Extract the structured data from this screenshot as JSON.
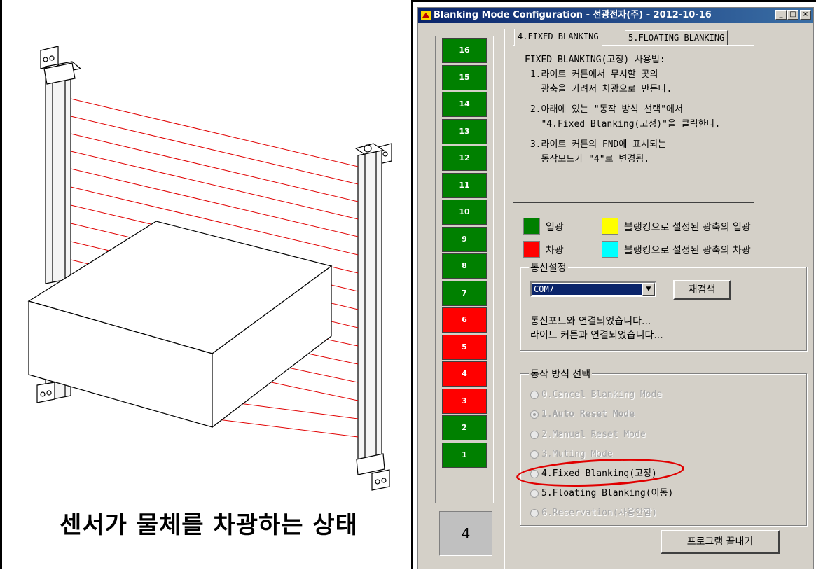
{
  "illustration": {
    "caption": "센서가 물체를 차광하는 상태"
  },
  "window": {
    "title": "Blanking Mode Configuration - 선광전자(주) - 2012-10-16",
    "controls": {
      "minimize": "_",
      "maximize": "□",
      "close": "×"
    }
  },
  "beams": [
    {
      "label": "16",
      "state": "on"
    },
    {
      "label": "15",
      "state": "on"
    },
    {
      "label": "14",
      "state": "on"
    },
    {
      "label": "13",
      "state": "on"
    },
    {
      "label": "12",
      "state": "on"
    },
    {
      "label": "11",
      "state": "on"
    },
    {
      "label": "10",
      "state": "on"
    },
    {
      "label": "9",
      "state": "on"
    },
    {
      "label": "8",
      "state": "on"
    },
    {
      "label": "7",
      "state": "on"
    },
    {
      "label": "6",
      "state": "off"
    },
    {
      "label": "5",
      "state": "off"
    },
    {
      "label": "4",
      "state": "off"
    },
    {
      "label": "3",
      "state": "off"
    },
    {
      "label": "2",
      "state": "on"
    },
    {
      "label": "1",
      "state": "on"
    }
  ],
  "mode_display": "4",
  "tabs": [
    {
      "label": "4.FIXED BLANKING",
      "active": true
    },
    {
      "label": "5.FLOATING BLANKING",
      "active": false
    }
  ],
  "tab_content": {
    "heading": "FIXED BLANKING(고정) 사용법:",
    "step1_line1": " 1.라이트 커튼에서 무시할 곳의",
    "step1_line2": "   광축을 가려서 차광으로 만든다.",
    "step2_line1": " 2.아래에 있는 \"동작 방식 선택\"에서",
    "step2_line2": "   \"4.Fixed Blanking(고정)\"을 클릭한다.",
    "step3_line1": " 3.라이트 커튼의 FND에 표시되는",
    "step3_line2": "   동작모드가 \"4\"로 변경됨."
  },
  "legend": {
    "green": {
      "label": "입광",
      "color": "#008000"
    },
    "red": {
      "label": "차광",
      "color": "#ff0000"
    },
    "yellow": {
      "label": "블랭킹으로 설정된 광축의 입광",
      "color": "#ffff00"
    },
    "cyan": {
      "label": "블랭킹으로 설정된 광축의 차광",
      "color": "#00ffff"
    }
  },
  "comm": {
    "title": "통신설정",
    "port": "COM7",
    "rescan_label": "재검색",
    "status_line1": "통신포트와 연결되었습니다...",
    "status_line2": "라이트 커튼과 연결되었습니다..."
  },
  "mode_select": {
    "title": "동작 방식 선택",
    "options": [
      {
        "label": "0.Cancel Blanking Mode",
        "enabled": false,
        "selected": false
      },
      {
        "label": "1.Auto Reset Mode",
        "enabled": false,
        "selected": true
      },
      {
        "label": "2.Manual Reset Mode",
        "enabled": false,
        "selected": false
      },
      {
        "label": "3.Muting Mode",
        "enabled": false,
        "selected": false
      },
      {
        "label": "4.Fixed Blanking(고정)",
        "enabled": true,
        "selected": false
      },
      {
        "label": "5.Floating Blanking(이동)",
        "enabled": true,
        "selected": false
      },
      {
        "label": "6.Reservation(사용안함)",
        "enabled": false,
        "selected": false
      }
    ]
  },
  "exit_label": "프로그램 끝내기"
}
